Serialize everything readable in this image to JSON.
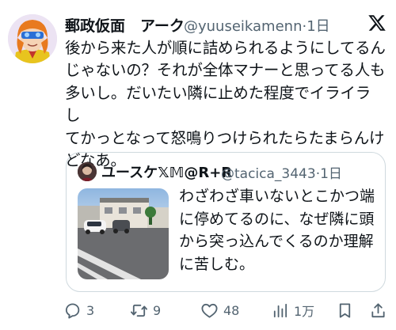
{
  "tweet": {
    "display_name": "郵政仮面　アーク",
    "handle": "@yuuseikamenn",
    "timestamp": "1日",
    "body": "後から来た人が順に詰められるようにしてるん\nじゃないの？それが全体マナーと思ってる人も\n多いし。だいたい隣に止めた程度でイライラし\nてかっとなって怒鳴りつけられたらたまらんけ\nどなあ。"
  },
  "quote": {
    "display_name": "ユースケ𝕏𝕄@R+R",
    "handle": "@tacica_3443",
    "timestamp": "1日",
    "body": "わざわざ車いないとこかつ端\nに停めてるのに、なぜ隣に頭\nから突っ込んでくるのか理解\nに苦しむ。"
  },
  "actions": {
    "reply_count": "3",
    "retweet_count": "9",
    "like_count": "48",
    "views_count": "1万"
  },
  "icons": {
    "logo": "x-logo-icon",
    "reply": "reply-icon",
    "retweet": "retweet-icon",
    "like": "heart-icon",
    "views": "views-icon",
    "bookmark": "bookmark-icon",
    "share": "share-icon"
  }
}
